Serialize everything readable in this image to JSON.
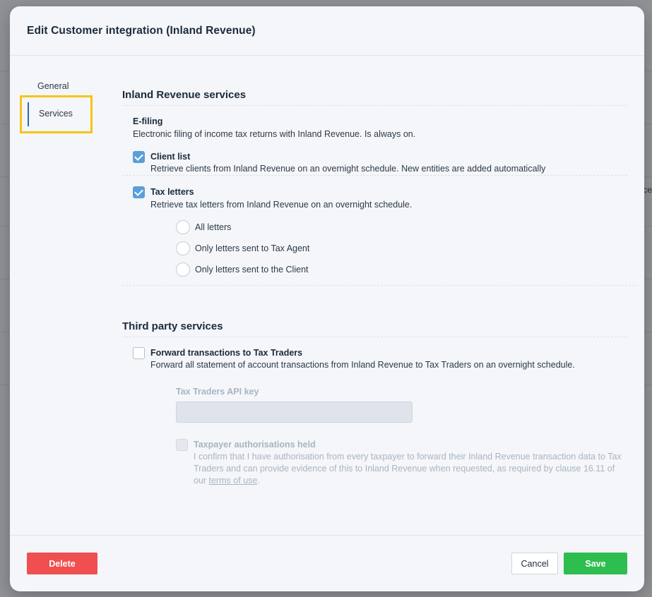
{
  "background": {
    "partial_text": "ce"
  },
  "modal": {
    "title": "Edit Customer integration (Inland Revenue)"
  },
  "nav": {
    "general": "General",
    "services": "Services"
  },
  "inland_revenue": {
    "title": "Inland Revenue services",
    "efiling": {
      "title": "E-filing",
      "desc": "Electronic filing of income tax returns with Inland Revenue. Is always on."
    },
    "client_list": {
      "title": "Client list",
      "desc": "Retrieve clients from Inland Revenue on an overnight schedule. New entities are added automatically",
      "checked": true
    },
    "tax_letters": {
      "title": "Tax letters",
      "desc": "Retrieve tax letters from Inland Revenue on an overnight schedule.",
      "checked": true,
      "options": [
        "All letters",
        "Only letters sent to Tax Agent",
        "Only letters sent to the Client"
      ]
    }
  },
  "third_party": {
    "title": "Third party services",
    "forward": {
      "title": "Forward transactions to Tax Traders",
      "desc": "Forward all statement of account transactions from Inland Revenue to Tax Traders on an overnight schedule.",
      "checked": false
    },
    "api_key": {
      "label": "Tax Traders API key",
      "value": ""
    },
    "authorisation": {
      "title": "Taxpayer authorisations held",
      "text_before_link": "I confirm that I have authorisation from every taxpayer to forward their Inland Revenue transaction data to Tax Traders and can provide evidence of this to Inland Revenue when requested, as required by clause 16.11 of our ",
      "link": "terms of use",
      "text_after_link": ".",
      "checked": false
    }
  },
  "footer": {
    "delete": "Delete",
    "cancel": "Cancel",
    "save": "Save"
  },
  "colors": {
    "highlight": "#f5c518",
    "checkbox": "#5a9fd9",
    "delete": "#ef4f4f",
    "save": "#2ebd4f"
  }
}
